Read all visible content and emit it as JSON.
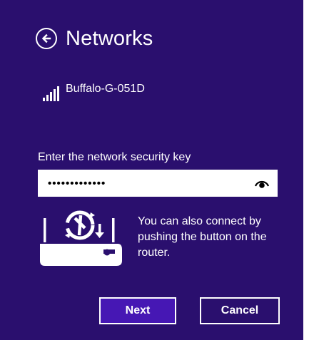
{
  "header": {
    "title": "Networks",
    "back_icon": "back-arrow-circle-icon"
  },
  "network": {
    "name": "Buffalo-G-051D",
    "signal_icon": "wifi-signal-icon"
  },
  "security_key": {
    "label": "Enter the network security key",
    "masked_value": "•••••••••••••",
    "reveal_icon": "eye-icon"
  },
  "router_hint": {
    "icon": "router-wps-icon",
    "text": "You can also connect by pushing the button on the router."
  },
  "buttons": {
    "next": "Next",
    "cancel": "Cancel"
  },
  "colors": {
    "background": "#2a0f6e",
    "accent_button": "#4617b4",
    "text": "#ffffff"
  }
}
